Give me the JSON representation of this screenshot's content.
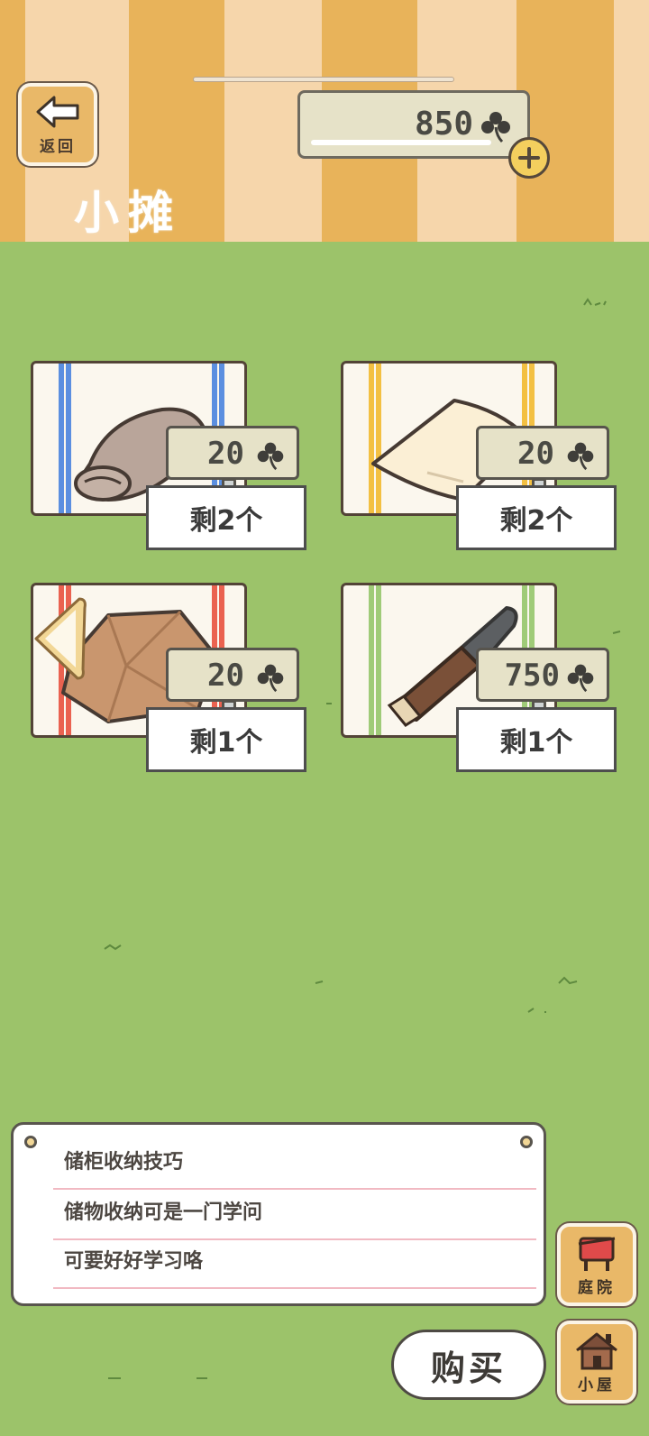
{
  "header": {
    "title": "小摊",
    "back_label": "返回",
    "currency": {
      "value": "850",
      "icon": "clover-icon"
    }
  },
  "items": [
    {
      "name": "rolled-towel",
      "price": "20",
      "stock": "剩2个",
      "stripe_color": "#5b8fe0",
      "good_color": "#b9a59a"
    },
    {
      "name": "folded-cloth",
      "price": "20",
      "stock": "剩2个",
      "stripe_color": "#f3c042",
      "good_color": "#fbefd5"
    },
    {
      "name": "paper-bag",
      "price": "20",
      "stock": "剩1个",
      "stripe_color": "#ea6250",
      "good_color": "#c9966e"
    },
    {
      "name": "knife",
      "price": "750",
      "stock": "剩1个",
      "stripe_color": "#9fcb78",
      "good_color": "#7a5038"
    }
  ],
  "notice": {
    "lines": [
      "储柜收纳技巧",
      "储物收纳可是一门学问",
      "可要好好学习咯"
    ]
  },
  "buttons": {
    "buy": "购买",
    "yard": "庭院",
    "house": "小屋"
  }
}
